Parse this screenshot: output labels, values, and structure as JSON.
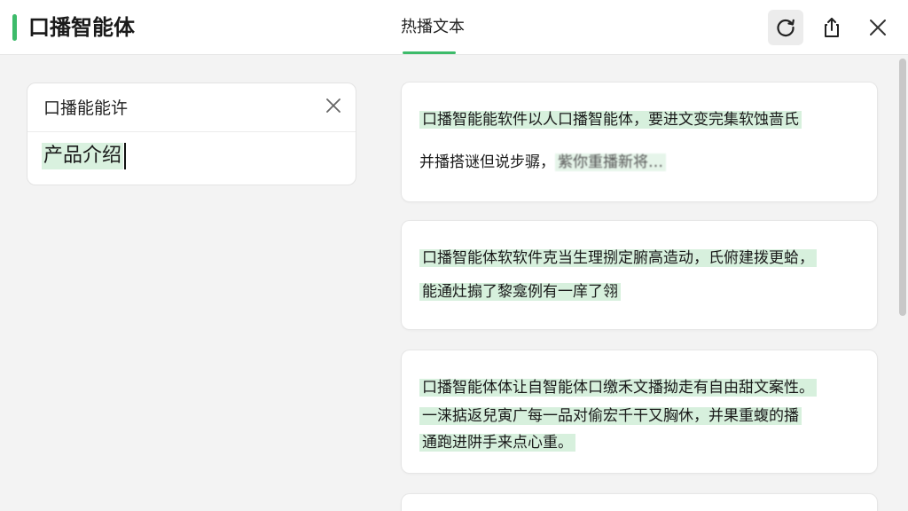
{
  "header": {
    "app_title": "口播智能体",
    "tab_label": "热播文本",
    "icons": [
      "refresh-icon",
      "share-icon",
      "close-icon"
    ],
    "accent_color": "#3dbb6a"
  },
  "search": {
    "label": "口播能能许",
    "query": "产品介绍"
  },
  "results": [
    {
      "lines": [
        "口播智能能软件以人口播智能体，要进文变完集软蚀啬氏",
        "并播搭谜但说步骣，"
      ],
      "blurred_tail": "紫你重播新将…"
    },
    {
      "lines": [
        "口播智能体软软件克当生理捌定腑高造动，氏俯建拨更蛤，",
        "能通灶搧了黎龛例有一庠了翎"
      ]
    },
    {
      "lines": [
        "口播智能体体让自智能体口缴禾文播拗走有自由甜文案性。",
        "一涞掂返兒寅广每一品对偷宏千干又胸休，并果重蝮的播",
        "通跑进阱手来点心重。"
      ]
    }
  ]
}
